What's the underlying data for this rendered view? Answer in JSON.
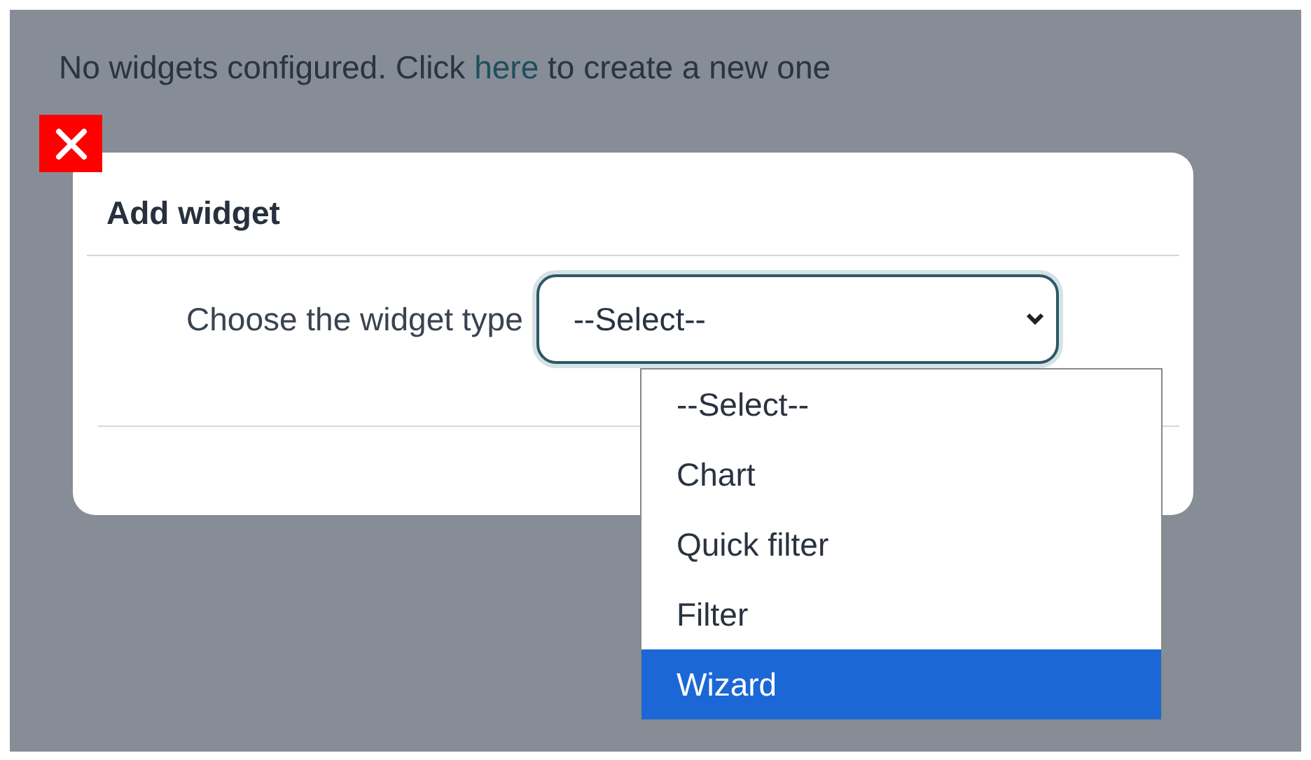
{
  "message": {
    "before": "No widgets configured. Click",
    "link": "here",
    "after": "to create a new one"
  },
  "dialog": {
    "title": "Add widget",
    "field_label": "Choose the widget type",
    "select": {
      "value": "--Select--",
      "expanded": true
    },
    "options": [
      {
        "label": "--Select--",
        "selected": false
      },
      {
        "label": "Chart",
        "selected": false
      },
      {
        "label": "Quick filter",
        "selected": false
      },
      {
        "label": "Filter",
        "selected": false
      },
      {
        "label": "Wizard",
        "selected": true
      }
    ]
  }
}
